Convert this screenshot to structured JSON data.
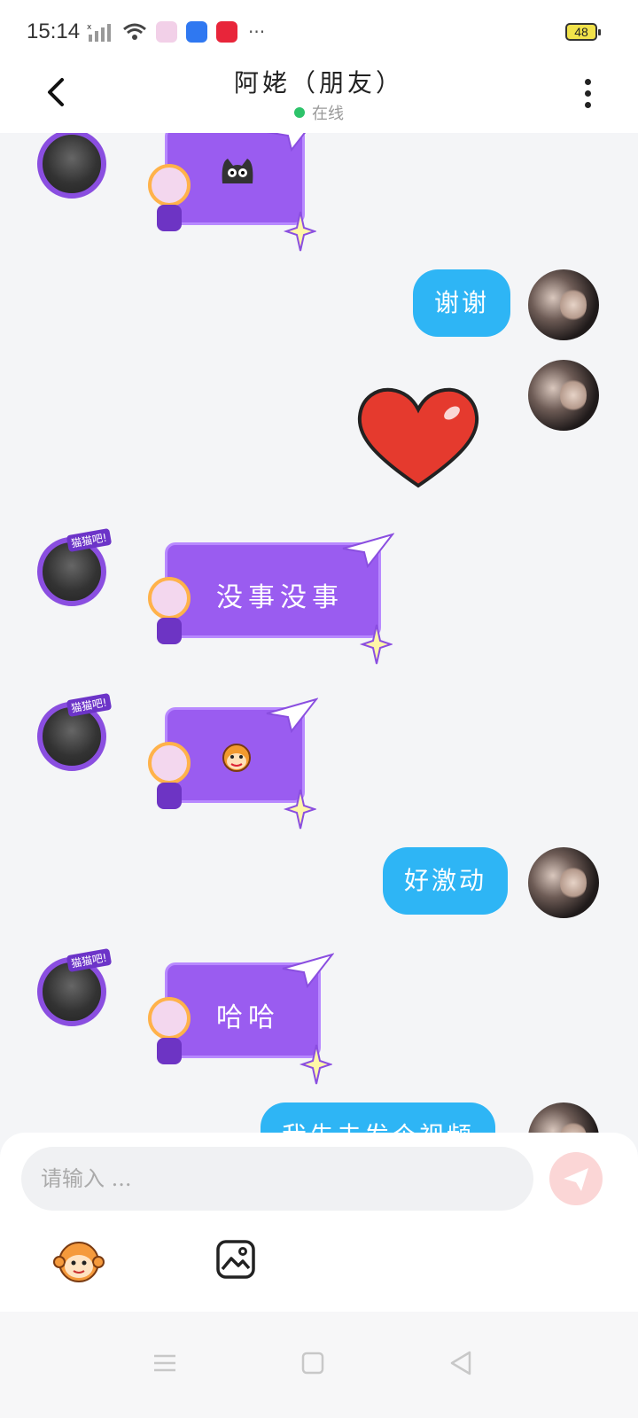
{
  "status_bar": {
    "time": "15:14",
    "battery": "48",
    "overflow": "···"
  },
  "header": {
    "title": "阿姥（朋友）",
    "status": "在线",
    "online_color": "#2dc36a"
  },
  "messages": [
    {
      "from": "friend",
      "type": "sticker",
      "sticker": "black-cat-face"
    },
    {
      "from": "me",
      "type": "text",
      "text": "谢谢"
    },
    {
      "from": "me",
      "type": "sticker",
      "sticker": "red-heart"
    },
    {
      "from": "friend",
      "type": "text",
      "text": "没事没事"
    },
    {
      "from": "friend",
      "type": "sticker",
      "sticker": "monkey-face"
    },
    {
      "from": "me",
      "type": "text",
      "text": "好激动"
    },
    {
      "from": "friend",
      "type": "text",
      "text": "哈哈"
    },
    {
      "from": "me",
      "type": "text",
      "text": "我先去发个视频"
    }
  ],
  "friend_badge": "猫猫吧!",
  "composer": {
    "placeholder": "请输入 ..."
  },
  "colors": {
    "my_bubble": "#2eb5f5",
    "friend_bubble": "#9a5cf0",
    "send_button": "#fbd6d6"
  },
  "icons": {
    "back": "chevron-left-icon",
    "menu": "more-vertical-icon",
    "send": "paper-plane-icon",
    "emoji": "monkey-emoji-icon",
    "image": "image-icon"
  }
}
